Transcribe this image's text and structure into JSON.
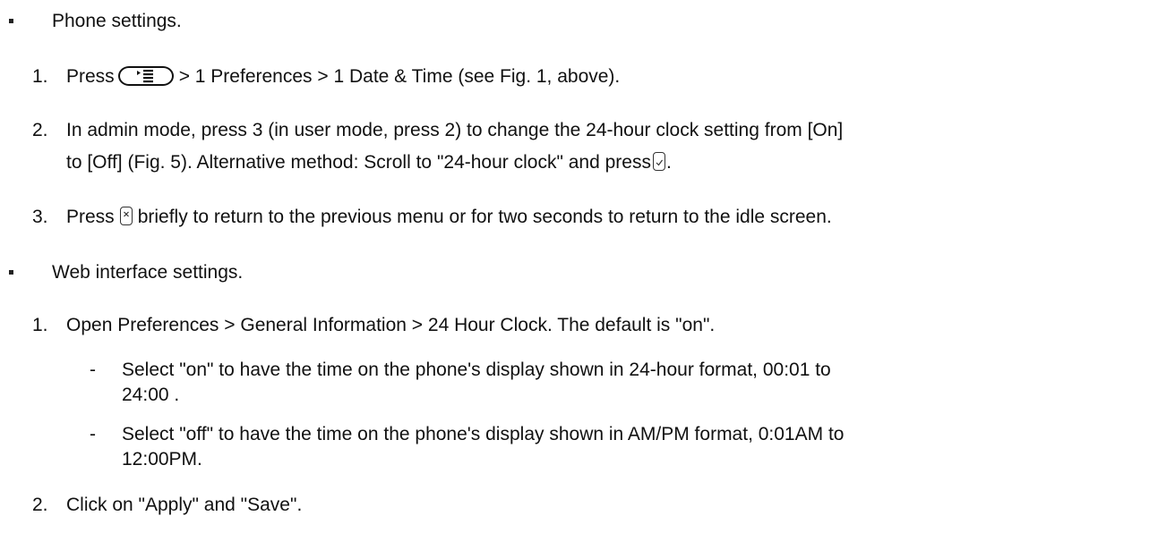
{
  "sections": [
    {
      "heading": "Phone settings.",
      "steps": [
        {
          "number": "1.",
          "parts": {
            "prefix": "Press",
            "path": "> 1 Preferences > 1 Date & Time (see Fig. 1, above).",
            "icon": "menu-key-icon"
          }
        },
        {
          "number": "2.",
          "line1": "In admin mode, press 3 (in user mode, press 2) to change the 24-hour clock setting from [On]",
          "line2_prefix": "to [Off] (Fig. 5).  Alternative method:  Scroll to \"24-hour clock\" and press",
          "line2_suffix": ".",
          "icon": "ok-key-icon"
        },
        {
          "number": "3.",
          "prefix": "Press",
          "suffix": "briefly to return to the previous menu or for two seconds to return to the idle screen.",
          "icon": "cancel-key-icon"
        }
      ]
    },
    {
      "heading": "Web interface settings.",
      "steps": [
        {
          "number": "1.",
          "text": "Open Preferences > General Information > 24 Hour Clock.  The default is \"on\".",
          "subitems": [
            {
              "dash": "-",
              "line1": "Select \"on\" to have the time on the phone's display shown in 24-hour format, 00:01 to",
              "line2": "24:00 ."
            },
            {
              "dash": "-",
              "line1": "Select \"off\" to have the time on the phone's display shown in AM/PM format, 0:01AM to",
              "line2": "12:00PM."
            }
          ]
        },
        {
          "number": "2.",
          "text": "Click on \"Apply\" and \"Save\"."
        }
      ]
    }
  ]
}
